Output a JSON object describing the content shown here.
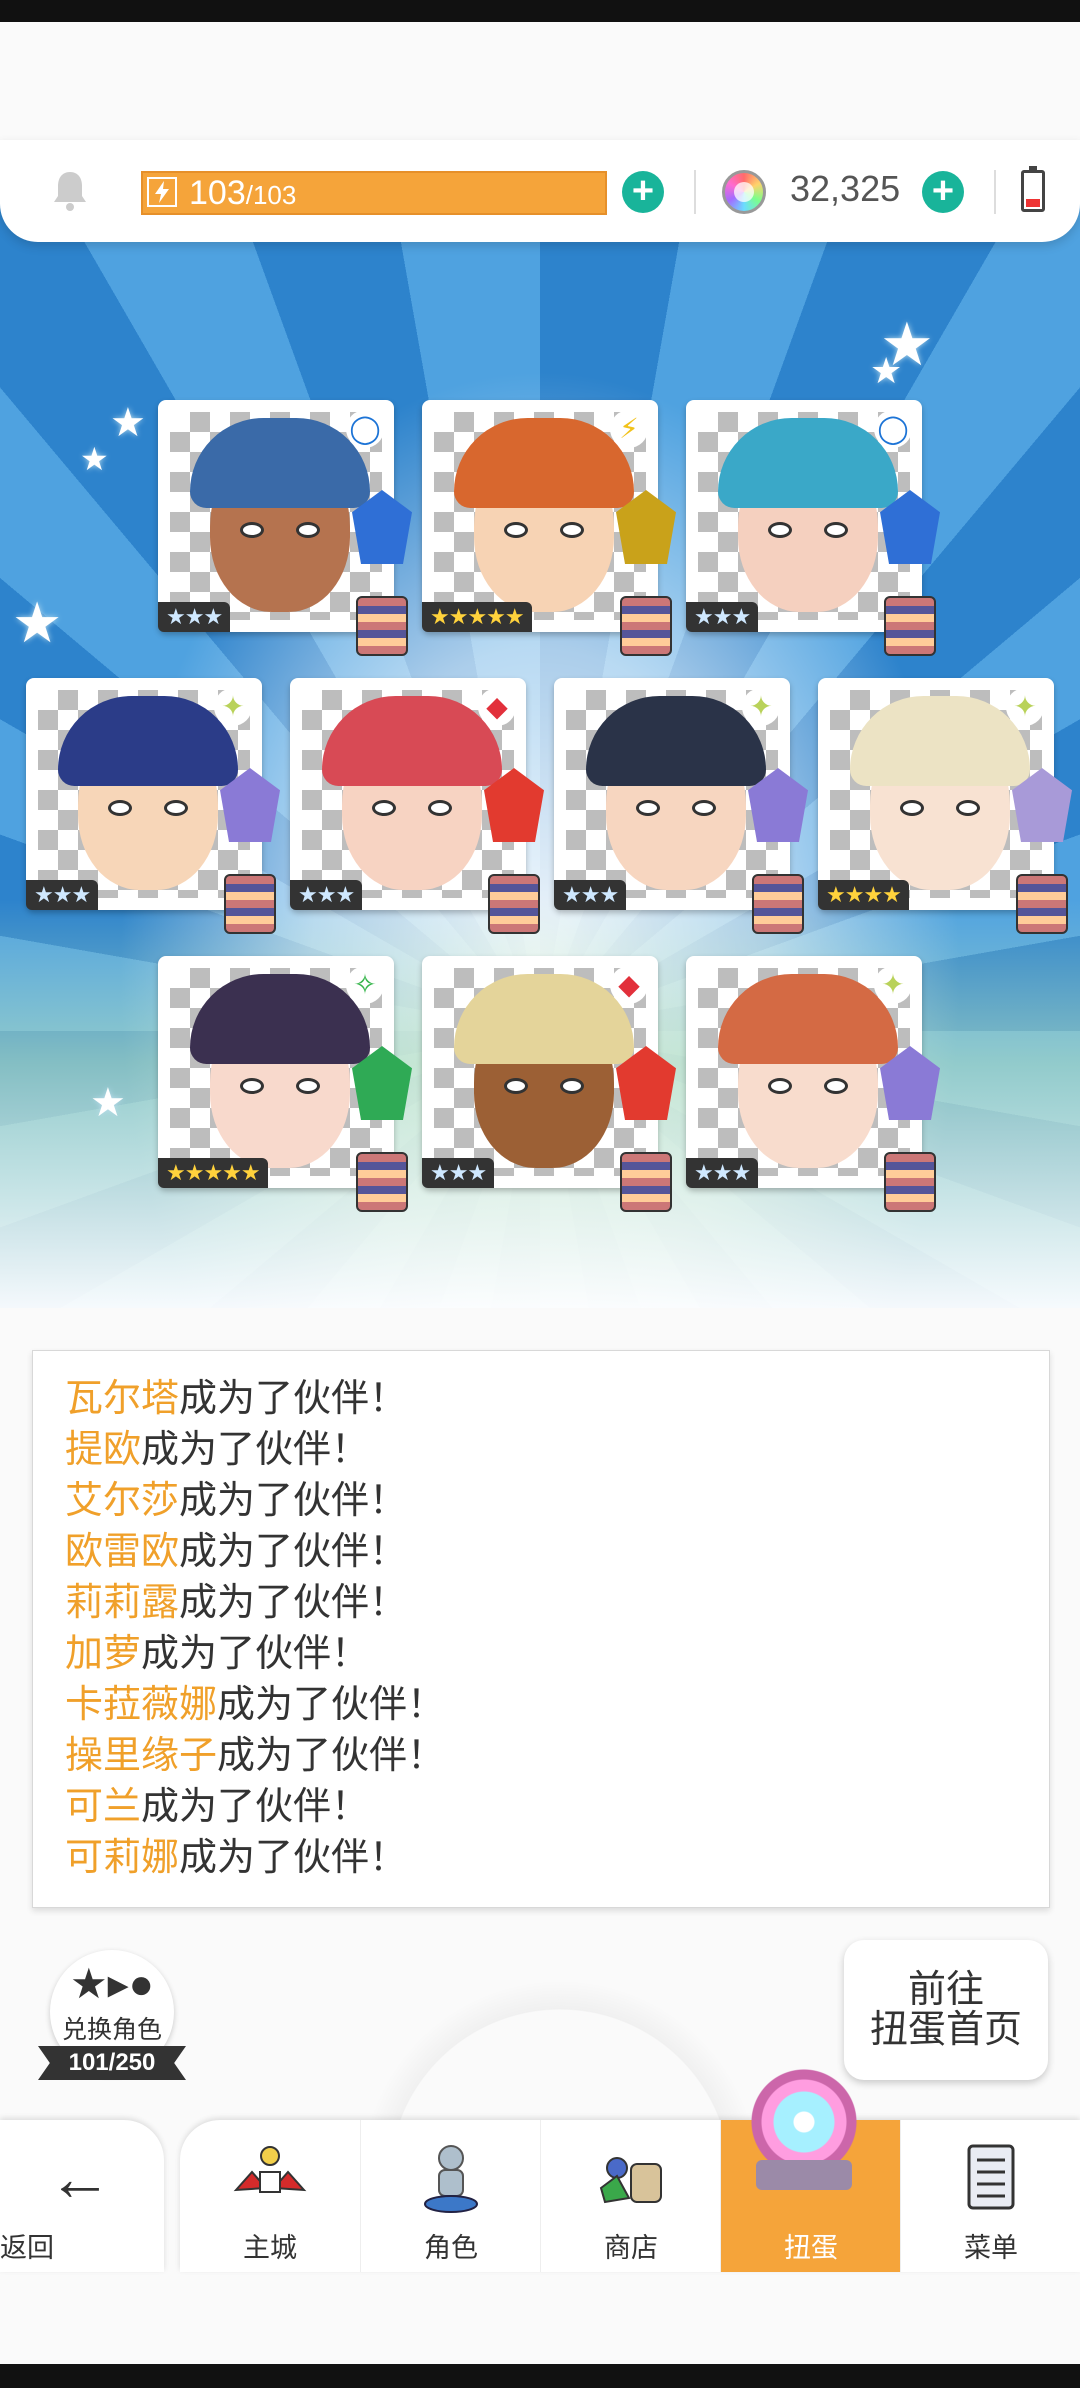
{
  "header": {
    "energy_current": "103",
    "energy_sep_max": "/103",
    "energy_plus_icon": "plus-icon",
    "gems": "32,325",
    "gem_plus_icon": "plus-icon"
  },
  "colors": {
    "accent": "#f5a43a",
    "name": "#f0a02a",
    "plus": "#19b49a"
  },
  "cards": [
    {
      "rarity": "★★★",
      "element": "water",
      "element_icon": "◯",
      "rarity_count": 3
    },
    {
      "rarity": "★★★★★",
      "element": "light",
      "element_icon": "⚡",
      "rarity_count": 5
    },
    {
      "rarity": "★★★",
      "element": "water",
      "element_icon": "◯",
      "rarity_count": 3
    },
    {
      "rarity": "★★★",
      "element": "holy",
      "element_icon": "✦",
      "rarity_count": 3
    },
    {
      "rarity": "★★★",
      "element": "fire",
      "element_icon": "◆",
      "rarity_count": 3
    },
    {
      "rarity": "★★★",
      "element": "holy",
      "element_icon": "✦",
      "rarity_count": 3
    },
    {
      "rarity": "★★★★",
      "element": "holy",
      "element_icon": "✦",
      "rarity_count": 4
    },
    {
      "rarity": "★★★★★",
      "element": "earth",
      "element_icon": "✧",
      "rarity_count": 5
    },
    {
      "rarity": "★★★",
      "element": "fire",
      "element_icon": "◆",
      "rarity_count": 3
    },
    {
      "rarity": "★★★",
      "element": "holy",
      "element_icon": "✦",
      "rarity_count": 3
    }
  ],
  "log": {
    "suffix": "成为了伙伴！",
    "names": [
      "瓦尔塔",
      "提欧",
      "艾尔莎",
      "欧雷欧",
      "莉莉露",
      "加萝",
      "卡菈薇娜",
      "操里缘子",
      "可兰",
      "可莉娜"
    ]
  },
  "exchange": {
    "label": "兑换角色",
    "count": "101/250",
    "icon": "star-to-person-icon"
  },
  "goto_button": {
    "line1": "前往",
    "line2": "扭蛋首页"
  },
  "nav": {
    "back": "返回",
    "tabs": [
      {
        "label": "主城",
        "icon": "castle-icon"
      },
      {
        "label": "角色",
        "icon": "character-icon"
      },
      {
        "label": "商店",
        "icon": "shop-icon"
      },
      {
        "label": "扭蛋",
        "icon": "gacha-icon",
        "active": true
      },
      {
        "label": "菜单",
        "icon": "menu-icon"
      }
    ]
  }
}
